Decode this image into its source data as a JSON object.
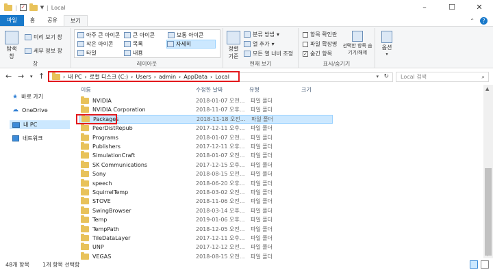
{
  "window": {
    "title": "Local"
  },
  "ribbon": {
    "tabs": [
      "파일",
      "홈",
      "공유",
      "보기"
    ],
    "groups": {
      "panes": {
        "label": "창",
        "nav_pane": "탐색 창",
        "preview": "미리 보기 창",
        "details": "세부 정보 창"
      },
      "layout": {
        "label": "레이아웃",
        "items": [
          "아주 큰 아이콘",
          "큰 아이콘",
          "보통 아이콘",
          "작은 아이콘",
          "목록",
          "자세히",
          "타일",
          "내용"
        ]
      },
      "current_view": {
        "label": "현재 보기",
        "sort": "정렬 기준",
        "group_by": "분류 방법",
        "add_columns": "열 추가",
        "fit_columns": "모든 열 너비 조정"
      },
      "show_hide": {
        "label": "표시/숨기기",
        "item_checkboxes": "항목 확인란",
        "extensions": "파일 확장명",
        "hidden_items": "숨긴 항목",
        "hide_selected": "선택한 항목 숨기기/해제"
      },
      "options": {
        "label": "옵션"
      }
    }
  },
  "address": {
    "crumbs": [
      "내 PC",
      "로컬 디스크 (C:)",
      "Users",
      "admin",
      "AppData",
      "Local"
    ],
    "search_placeholder": "Local 검색"
  },
  "nav_pane": {
    "items": [
      "바로 가기",
      "OneDrive",
      "내 PC",
      "네트워크"
    ]
  },
  "columns": [
    "이름",
    "수정한 날짜",
    "유형",
    "크기"
  ],
  "files": [
    {
      "name": "NVIDIA",
      "date": "2018-01-07 오전...",
      "type": "파일 폴더"
    },
    {
      "name": "NVIDIA Corporation",
      "date": "2018-11-07 오후...",
      "type": "파일 폴더"
    },
    {
      "name": "Packages",
      "date": "2018-11-18 오전...",
      "type": "파일 폴더"
    },
    {
      "name": "PeerDistRepub",
      "date": "2017-12-11 오후...",
      "type": "파일 폴더"
    },
    {
      "name": "Programs",
      "date": "2018-01-07 오전...",
      "type": "파일 폴더"
    },
    {
      "name": "Publishers",
      "date": "2017-12-11 오후...",
      "type": "파일 폴더"
    },
    {
      "name": "SimulationCraft",
      "date": "2018-01-07 오전...",
      "type": "파일 폴더"
    },
    {
      "name": "SK Communications",
      "date": "2017-12-15 오후...",
      "type": "파일 폴더"
    },
    {
      "name": "Sony",
      "date": "2018-08-15 오전...",
      "type": "파일 폴더"
    },
    {
      "name": "speech",
      "date": "2018-06-20 오후...",
      "type": "파일 폴더"
    },
    {
      "name": "SquirrelTemp",
      "date": "2018-03-02 오전...",
      "type": "파일 폴더"
    },
    {
      "name": "STOVE",
      "date": "2018-11-06 오전...",
      "type": "파일 폴더"
    },
    {
      "name": "SwingBrowser",
      "date": "2018-03-14 오후...",
      "type": "파일 폴더"
    },
    {
      "name": "Temp",
      "date": "2019-01-06 오후...",
      "type": "파일 폴더"
    },
    {
      "name": "TempPath",
      "date": "2018-12-05 오전...",
      "type": "파일 폴더"
    },
    {
      "name": "TileDataLayer",
      "date": "2017-12-11 오후...",
      "type": "파일 폴더"
    },
    {
      "name": "UNP",
      "date": "2017-12-12 오전...",
      "type": "파일 폴더"
    },
    {
      "name": "VEGAS",
      "date": "2018-08-15 오전...",
      "type": "파일 폴더"
    }
  ],
  "status": {
    "count": "48개 항목",
    "selected": "1개 항목 선택함"
  },
  "colors": {
    "accent": "#1979ca",
    "selection": "#cce8ff",
    "highlight_box": "#e3181c",
    "folder": "#e8c25a"
  }
}
